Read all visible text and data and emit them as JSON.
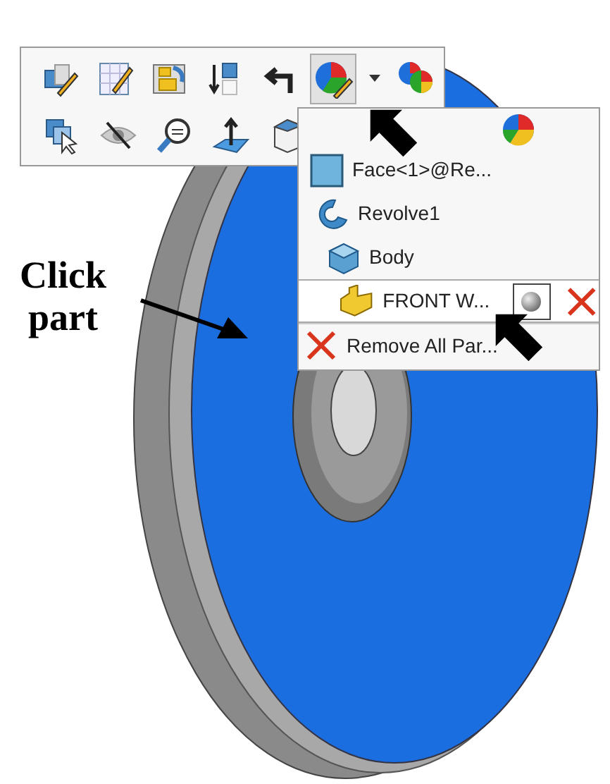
{
  "callout": {
    "lines": [
      "Click",
      "part"
    ]
  },
  "toolbar": {
    "rows": [
      [
        {
          "kind": "edit-part",
          "selected": false
        },
        {
          "kind": "sketch",
          "selected": false
        },
        {
          "kind": "folder",
          "selected": false
        },
        {
          "kind": "move-down",
          "selected": false
        },
        {
          "kind": "back",
          "selected": false
        },
        {
          "kind": "appearance",
          "selected": true
        },
        {
          "kind": "dropdown",
          "selected": false
        },
        {
          "kind": "appearances",
          "selected": false
        }
      ],
      [
        {
          "kind": "select",
          "selected": false
        },
        {
          "kind": "hide",
          "selected": false
        },
        {
          "kind": "zoom",
          "selected": false
        },
        {
          "kind": "normal",
          "selected": false
        },
        {
          "kind": "view",
          "selected": false
        }
      ]
    ]
  },
  "menu": {
    "items": [
      {
        "kind": "face",
        "label": "Face<1>@Re...",
        "selected": false
      },
      {
        "kind": "feature",
        "label": "Revolve1",
        "selected": false
      },
      {
        "kind": "body",
        "label": "Body",
        "selected": false
      },
      {
        "kind": "part",
        "label": "FRONT W...",
        "selected": true
      },
      {
        "kind": "remove",
        "label": "Remove All Par...",
        "selected": false
      }
    ]
  }
}
